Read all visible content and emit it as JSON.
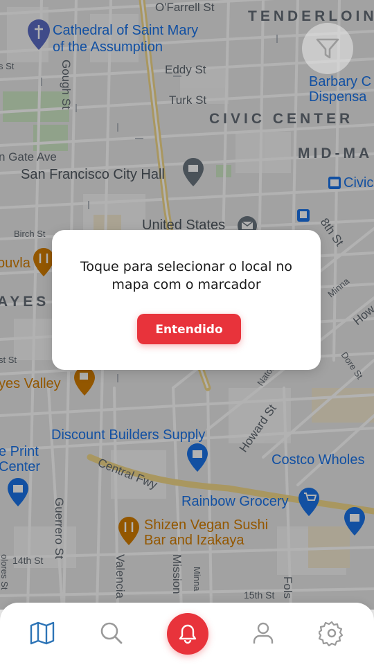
{
  "map": {
    "labels": {
      "ofarrell_st": "O'Farrell St",
      "tenderloin": "TENDERLOIN",
      "cathedral_1": "Cathedral of Saint Mary",
      "cathedral_2": "of the Assumption",
      "gough_st": "Gough St",
      "eddy_st": "Eddy St",
      "turk_st": "Turk St",
      "barbary_1": "Barbary C",
      "barbary_2": "Dispensa",
      "civic_center": "CIVIC CENTER",
      "golden_gate_ave": "n Gate Ave",
      "mid_market": "MID-MA",
      "city_hall": "San Francisco City Hall",
      "civic_bart": "Civic",
      "united_states": "United States",
      "birch_st": "Birch St",
      "eighth_st": "8th St",
      "souvla": "ouvla",
      "hayes": "AYES",
      "minna_st": "Minna",
      "howard_st_top": "How",
      "dore_st": "Dore St",
      "hayes_valley": "yes Valley",
      "natoma": "Natom",
      "howard_st": "Howard St",
      "discount_builders": "Discount Builders Supply",
      "eprint_1": "e Print",
      "eprint_2": "Center",
      "costco": "Costco Wholes",
      "central_fwy": "Central Fwy",
      "rainbow_grocery": "Rainbow Grocery",
      "guerrero_st": "Guerrero St",
      "shizen_1": "Shizen Vegan Sushi",
      "shizen_2": "Bar and Izakaya",
      "fourteenth_st": "14th St",
      "valencia_st": "Valencia",
      "mission_st": "Mission",
      "minna_st_2": "Minna",
      "fifteenth_st": "15th St",
      "folsom_st": "Fols",
      "street_left_1": "s St",
      "street_left_2": "st St",
      "street_left_3": "olores St"
    }
  },
  "filter": {
    "icon": "filter-icon"
  },
  "dialog": {
    "message": "Toque para selecionar o local no mapa com o marcador",
    "button_label": "Entendido"
  },
  "nav": {
    "items": [
      {
        "icon": "map-icon",
        "active": true
      },
      {
        "icon": "search-icon",
        "active": false
      },
      {
        "icon": "bell-icon",
        "active": false
      },
      {
        "icon": "user-icon",
        "active": false
      },
      {
        "icon": "gear-icon",
        "active": false
      }
    ]
  },
  "colors": {
    "accent": "#e8333b",
    "active_icon": "#2d74b6",
    "inactive_icon": "#9a9a9a",
    "poi_blue": "#1a73e8",
    "poi_orange": "#d37d00",
    "district_text": "#646c76"
  }
}
